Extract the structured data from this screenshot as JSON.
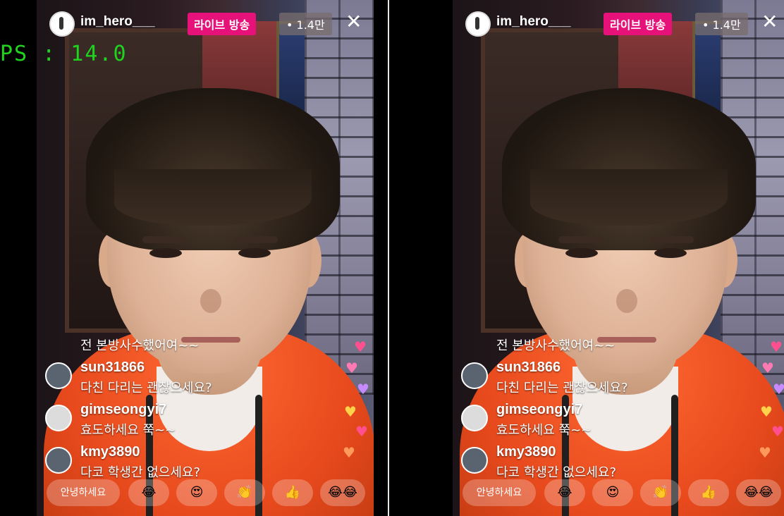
{
  "fps_overlay": "PS : 14.0",
  "stream": {
    "username": "im_hero___",
    "live_label": "라이브 방송",
    "viewer_count": "• 1.4만",
    "close_glyph": "✕"
  },
  "comments": {
    "pinned": "전 본방사수했어여~~",
    "items": [
      {
        "user": "sun31866",
        "text": "다친 다리는 괜찮으세요?"
      },
      {
        "user": "gimseongyi7",
        "text": "효도하세요 쭉~~"
      },
      {
        "user": "kmy3890",
        "text": "다코 학생간 없으세요?"
      }
    ]
  },
  "bottom_bar": {
    "hello_label": "안녕하세요",
    "emojis": [
      "😂",
      "😍",
      "👏",
      "👍",
      "😂😂"
    ]
  },
  "colors": {
    "live_badge": "#e6127a",
    "fps_text": "#1fd31f",
    "divider": "#e8e8e8"
  }
}
